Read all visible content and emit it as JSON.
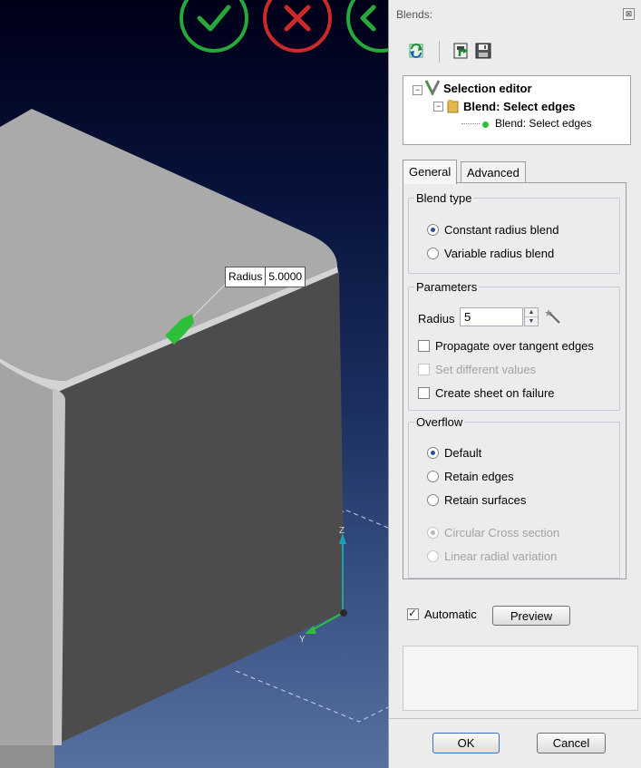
{
  "viewport": {
    "radius_tooltip": {
      "label": "Radius",
      "value": "5.0000"
    },
    "axis_z_label": "Z",
    "axis_y_label": "Y"
  },
  "panel": {
    "title": "Blends:",
    "close_glyph": "⊠",
    "tree": {
      "root": "Selection editor",
      "child": "Blend: Select edges",
      "leaf": "Blend: Select edges"
    },
    "tabs": [
      "General",
      "Advanced"
    ],
    "blend_type": {
      "title": "Blend type",
      "options": [
        "Constant radius blend",
        "Variable radius blend"
      ],
      "selected": 0
    },
    "parameters": {
      "title": "Parameters",
      "radius_label": "Radius",
      "radius_value": "5",
      "checks": [
        {
          "label": "Propagate over tangent edges",
          "checked": false,
          "disabled": false
        },
        {
          "label": "Set different values",
          "checked": false,
          "disabled": true
        },
        {
          "label": "Create sheet on failure",
          "checked": false,
          "disabled": false
        }
      ]
    },
    "overflow": {
      "title": "Overflow",
      "options": [
        "Default",
        "Retain edges",
        "Retain surfaces"
      ],
      "selected": 0,
      "disabled_options": [
        "Circular Cross section",
        "Linear radial variation"
      ],
      "disabled_selected": 0
    },
    "automatic_label": "Automatic",
    "automatic_checked": true,
    "preview_label": "Preview",
    "ok_label": "OK",
    "cancel_label": "Cancel"
  },
  "colors": {
    "accept_green": "#27a83a",
    "cancel_red": "#cc2a2a",
    "radio_blue": "#2d4f9a"
  }
}
